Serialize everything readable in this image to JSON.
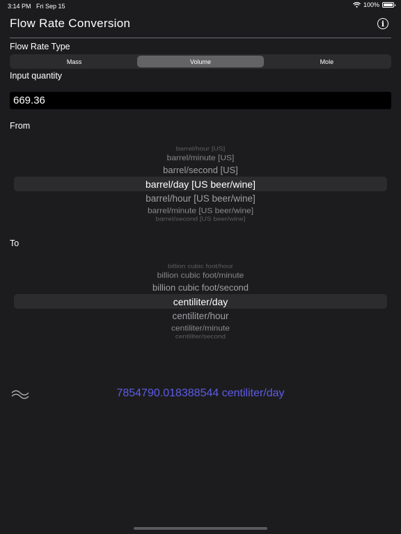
{
  "status_bar": {
    "time": "3:14 PM",
    "date": "Fri Sep 15",
    "battery": "100%",
    "battery_level": 1.0,
    "wifi_icon": "wifi-icon",
    "battery_icon": "battery-icon"
  },
  "header": {
    "title": "Flow Rate Conversion",
    "info_icon": "info-icon"
  },
  "flow_rate_type": {
    "label": "Flow Rate Type",
    "segments": [
      "Mass",
      "Volume",
      "Mole"
    ],
    "selected": "Volume"
  },
  "input_quantity": {
    "label": "Input quantity",
    "value": "669.36"
  },
  "from_picker": {
    "label": "From",
    "items_above": [
      "barrel/hour [US]",
      "barrel/minute [US]",
      "barrel/second [US]"
    ],
    "selected": "barrel/day [US beer/wine]",
    "items_below": [
      "barrel/hour [US beer/wine]",
      "barrel/minute [US beer/wine]",
      "barrel/second [US beer/wine]"
    ]
  },
  "to_picker": {
    "label": "To",
    "items_above": [
      "billion cubic foot/hour",
      "billion cubic foot/minute",
      "billion cubic foot/second"
    ],
    "selected": "centiliter/day",
    "items_below": [
      "centiliter/hour",
      "centiliter/minute",
      "centiliter/second"
    ]
  },
  "result": {
    "approx_icon": "approximately-equal-icon",
    "text": "7854790.018388544 centiliter/day",
    "color": "#5e5ce6"
  }
}
